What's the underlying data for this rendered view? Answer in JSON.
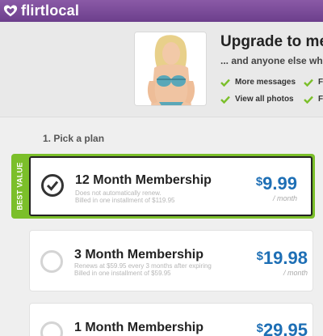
{
  "brand": {
    "name": "flirtlocal"
  },
  "promo": {
    "title": "Upgrade to me",
    "subtitle": "... and anyone else wh",
    "benefits": [
      {
        "label": "More messages"
      },
      {
        "label": "View all photos"
      },
      {
        "label": "F"
      },
      {
        "label": "F"
      }
    ],
    "accent_color": "#7bbf2a"
  },
  "step": {
    "label": "1. Pick a plan"
  },
  "plans": [
    {
      "badge": "BEST VALUE",
      "name": "12 Month Membership",
      "note1": "Does not automatically renew.",
      "note2": "Billed in one installment of $119.95",
      "currency": "$",
      "amount": "9.99",
      "per": "/ month",
      "selected": true
    },
    {
      "name": "3 Month Membership",
      "note1": "Renews at $59.95 every 3 months after expiring",
      "note2": "Billed in one installment of $59.95",
      "currency": "$",
      "amount": "19.98",
      "per": "/ month",
      "selected": false
    },
    {
      "name": "1 Month Membership",
      "currency": "$",
      "amount": "29.95",
      "selected": false
    }
  ],
  "colors": {
    "top_bar": "#6c3f8c",
    "price": "#1e6fb5",
    "best_value": "#7bbf2a"
  }
}
